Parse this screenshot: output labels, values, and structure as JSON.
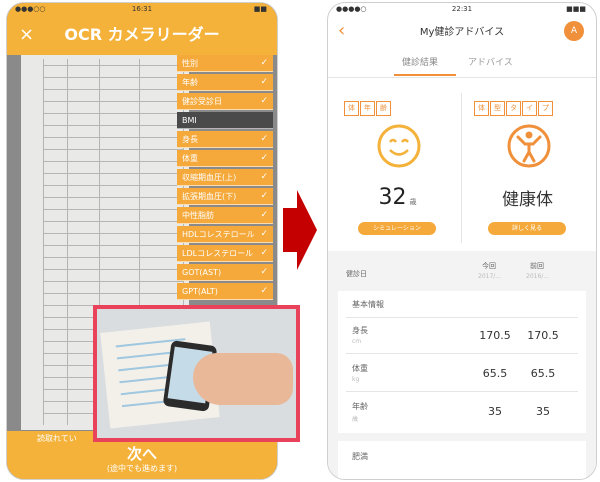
{
  "colors": {
    "accent": "#f4b23a",
    "accent2": "#f0903a",
    "inset_border": "#e8435a",
    "arrow": "#cc0000"
  },
  "left_phone": {
    "statusbar": {
      "time": "16:31",
      "carrier": "●●●○○",
      "battery": "■■"
    },
    "header": {
      "close_icon": "close-icon",
      "close_glyph": "×",
      "title": "OCR カメラリーダー"
    },
    "fields": [
      {
        "label": "性別",
        "checked": true,
        "dark": false
      },
      {
        "label": "年齢",
        "checked": true,
        "dark": false
      },
      {
        "label": "健診受診日",
        "checked": true,
        "dark": false
      },
      {
        "label": "BMI",
        "checked": false,
        "dark": true
      },
      {
        "label": "身長",
        "checked": true,
        "dark": false
      },
      {
        "label": "体重",
        "checked": true,
        "dark": false
      },
      {
        "label": "収縮期血圧(上)",
        "checked": true,
        "dark": false
      },
      {
        "label": "拡張期血圧(下)",
        "checked": true,
        "dark": false
      },
      {
        "label": "中性脂肪",
        "checked": true,
        "dark": false
      },
      {
        "label": "HDLコレステロール",
        "checked": true,
        "dark": false
      },
      {
        "label": "LDLコレステロール",
        "checked": true,
        "dark": false
      },
      {
        "label": "GOT(AST)",
        "checked": true,
        "dark": false
      },
      {
        "label": "GPT(ALT)",
        "checked": true,
        "dark": false
      }
    ],
    "check_glyph": "✓",
    "footer": {
      "status": "読取れてい",
      "next_label": "次へ",
      "next_sub": "(途中でも進めます)"
    }
  },
  "arrow_glyph": "▶",
  "right_phone": {
    "statusbar": {
      "carrier": "●●●●○",
      "time": "22:31",
      "battery": "■■■"
    },
    "header": {
      "back_glyph": "‹",
      "title": "My健診アドバイス",
      "icon_glyph": "A"
    },
    "tabs": [
      {
        "label": "健診結果",
        "active": true
      },
      {
        "label": "アドバイス",
        "active": false
      }
    ],
    "cards": [
      {
        "badges": [
          "体",
          "年",
          "齢"
        ],
        "value": "32",
        "unit": "歳",
        "pill": "シミュレーション"
      },
      {
        "badges": [
          "体",
          "型",
          "タ",
          "イ",
          "プ"
        ],
        "value": "健康体",
        "pill": "詳しく見る"
      }
    ],
    "table": {
      "header": {
        "label": "健診日",
        "col1": "今回",
        "col2": "前回",
        "col1_sub": "2017/...",
        "col2_sub": "2016/..."
      },
      "section1": {
        "title": "基本情報",
        "rows": [
          {
            "label": "身長",
            "unit": "cm",
            "current": "170.5",
            "previous": "170.5"
          },
          {
            "label": "体重",
            "unit": "kg",
            "current": "65.5",
            "previous": "65.5"
          },
          {
            "label": "年齢",
            "unit": "歳",
            "current": "35",
            "previous": "35"
          }
        ]
      },
      "section2": {
        "title": "肥満"
      }
    }
  }
}
